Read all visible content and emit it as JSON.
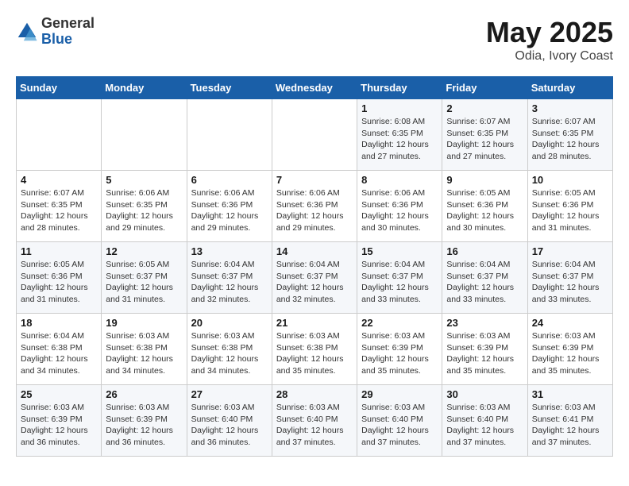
{
  "logo": {
    "general": "General",
    "blue": "Blue"
  },
  "title": "May 2025",
  "subtitle": "Odia, Ivory Coast",
  "days_of_week": [
    "Sunday",
    "Monday",
    "Tuesday",
    "Wednesday",
    "Thursday",
    "Friday",
    "Saturday"
  ],
  "weeks": [
    [
      {
        "day": "",
        "info": ""
      },
      {
        "day": "",
        "info": ""
      },
      {
        "day": "",
        "info": ""
      },
      {
        "day": "",
        "info": ""
      },
      {
        "day": "1",
        "info": "Sunrise: 6:08 AM\nSunset: 6:35 PM\nDaylight: 12 hours\nand 27 minutes."
      },
      {
        "day": "2",
        "info": "Sunrise: 6:07 AM\nSunset: 6:35 PM\nDaylight: 12 hours\nand 27 minutes."
      },
      {
        "day": "3",
        "info": "Sunrise: 6:07 AM\nSunset: 6:35 PM\nDaylight: 12 hours\nand 28 minutes."
      }
    ],
    [
      {
        "day": "4",
        "info": "Sunrise: 6:07 AM\nSunset: 6:35 PM\nDaylight: 12 hours\nand 28 minutes."
      },
      {
        "day": "5",
        "info": "Sunrise: 6:06 AM\nSunset: 6:35 PM\nDaylight: 12 hours\nand 29 minutes."
      },
      {
        "day": "6",
        "info": "Sunrise: 6:06 AM\nSunset: 6:36 PM\nDaylight: 12 hours\nand 29 minutes."
      },
      {
        "day": "7",
        "info": "Sunrise: 6:06 AM\nSunset: 6:36 PM\nDaylight: 12 hours\nand 29 minutes."
      },
      {
        "day": "8",
        "info": "Sunrise: 6:06 AM\nSunset: 6:36 PM\nDaylight: 12 hours\nand 30 minutes."
      },
      {
        "day": "9",
        "info": "Sunrise: 6:05 AM\nSunset: 6:36 PM\nDaylight: 12 hours\nand 30 minutes."
      },
      {
        "day": "10",
        "info": "Sunrise: 6:05 AM\nSunset: 6:36 PM\nDaylight: 12 hours\nand 31 minutes."
      }
    ],
    [
      {
        "day": "11",
        "info": "Sunrise: 6:05 AM\nSunset: 6:36 PM\nDaylight: 12 hours\nand 31 minutes."
      },
      {
        "day": "12",
        "info": "Sunrise: 6:05 AM\nSunset: 6:37 PM\nDaylight: 12 hours\nand 31 minutes."
      },
      {
        "day": "13",
        "info": "Sunrise: 6:04 AM\nSunset: 6:37 PM\nDaylight: 12 hours\nand 32 minutes."
      },
      {
        "day": "14",
        "info": "Sunrise: 6:04 AM\nSunset: 6:37 PM\nDaylight: 12 hours\nand 32 minutes."
      },
      {
        "day": "15",
        "info": "Sunrise: 6:04 AM\nSunset: 6:37 PM\nDaylight: 12 hours\nand 33 minutes."
      },
      {
        "day": "16",
        "info": "Sunrise: 6:04 AM\nSunset: 6:37 PM\nDaylight: 12 hours\nand 33 minutes."
      },
      {
        "day": "17",
        "info": "Sunrise: 6:04 AM\nSunset: 6:37 PM\nDaylight: 12 hours\nand 33 minutes."
      }
    ],
    [
      {
        "day": "18",
        "info": "Sunrise: 6:04 AM\nSunset: 6:38 PM\nDaylight: 12 hours\nand 34 minutes."
      },
      {
        "day": "19",
        "info": "Sunrise: 6:03 AM\nSunset: 6:38 PM\nDaylight: 12 hours\nand 34 minutes."
      },
      {
        "day": "20",
        "info": "Sunrise: 6:03 AM\nSunset: 6:38 PM\nDaylight: 12 hours\nand 34 minutes."
      },
      {
        "day": "21",
        "info": "Sunrise: 6:03 AM\nSunset: 6:38 PM\nDaylight: 12 hours\nand 35 minutes."
      },
      {
        "day": "22",
        "info": "Sunrise: 6:03 AM\nSunset: 6:39 PM\nDaylight: 12 hours\nand 35 minutes."
      },
      {
        "day": "23",
        "info": "Sunrise: 6:03 AM\nSunset: 6:39 PM\nDaylight: 12 hours\nand 35 minutes."
      },
      {
        "day": "24",
        "info": "Sunrise: 6:03 AM\nSunset: 6:39 PM\nDaylight: 12 hours\nand 35 minutes."
      }
    ],
    [
      {
        "day": "25",
        "info": "Sunrise: 6:03 AM\nSunset: 6:39 PM\nDaylight: 12 hours\nand 36 minutes."
      },
      {
        "day": "26",
        "info": "Sunrise: 6:03 AM\nSunset: 6:39 PM\nDaylight: 12 hours\nand 36 minutes."
      },
      {
        "day": "27",
        "info": "Sunrise: 6:03 AM\nSunset: 6:40 PM\nDaylight: 12 hours\nand 36 minutes."
      },
      {
        "day": "28",
        "info": "Sunrise: 6:03 AM\nSunset: 6:40 PM\nDaylight: 12 hours\nand 37 minutes."
      },
      {
        "day": "29",
        "info": "Sunrise: 6:03 AM\nSunset: 6:40 PM\nDaylight: 12 hours\nand 37 minutes."
      },
      {
        "day": "30",
        "info": "Sunrise: 6:03 AM\nSunset: 6:40 PM\nDaylight: 12 hours\nand 37 minutes."
      },
      {
        "day": "31",
        "info": "Sunrise: 6:03 AM\nSunset: 6:41 PM\nDaylight: 12 hours\nand 37 minutes."
      }
    ]
  ]
}
